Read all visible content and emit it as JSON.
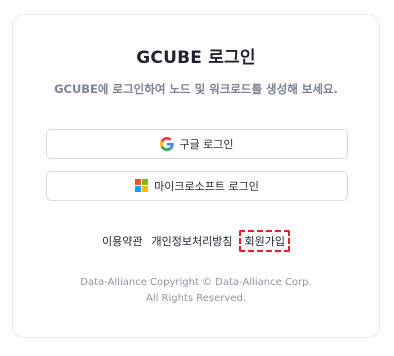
{
  "login": {
    "title": "GCUBE 로그인",
    "subtitle": "GCUBE에 로그인하여 노드 및 워크로드를 생성해 보세요.",
    "google_label": "구글 로그인",
    "microsoft_label": "마이크로소프트 로그인"
  },
  "links": {
    "terms": "이용약관",
    "privacy": "개인정보처리방침",
    "signup": "회원가입"
  },
  "footer": {
    "copyright": "Data-Alliance Copyright © Data-Alliance Corp.",
    "rights": "All Rights Reserved."
  },
  "colors": {
    "signup_highlight": "#e5202a",
    "microsoft_red": "#f25022",
    "microsoft_green": "#7fba00",
    "microsoft_blue": "#00a4ef",
    "microsoft_yellow": "#ffb900"
  },
  "icons": {
    "google": "google-icon",
    "microsoft": "microsoft-icon"
  }
}
